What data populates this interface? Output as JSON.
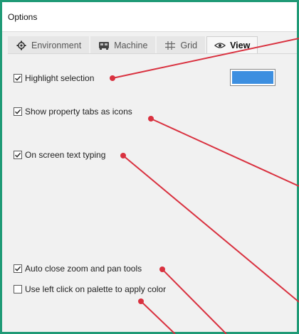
{
  "window": {
    "title": "Options"
  },
  "tabs": [
    {
      "label": "Environment",
      "icon": "settings-icon",
      "active": false
    },
    {
      "label": "Machine",
      "icon": "machine-icon",
      "active": false
    },
    {
      "label": "Grid",
      "icon": "grid-icon",
      "active": false
    },
    {
      "label": "View",
      "icon": "eye-icon",
      "active": true
    }
  ],
  "options": [
    {
      "label": "Highlight selection",
      "checked": true
    },
    {
      "label": "Show property tabs as icons",
      "checked": true
    },
    {
      "label": "On screen text typing",
      "checked": true
    },
    {
      "label": "Auto close zoom and pan tools",
      "checked": true
    },
    {
      "label": "Use left click on palette to apply color",
      "checked": false
    }
  ],
  "highlight_color": "#3d8fe0",
  "colors": {
    "frame_border": "#1f9a76",
    "callout": "#d9313f"
  }
}
